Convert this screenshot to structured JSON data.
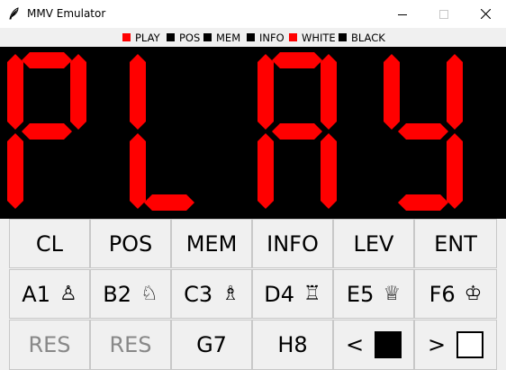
{
  "window": {
    "title": "MMV Emulator"
  },
  "indicators": [
    {
      "label": "PLAY",
      "color": "#ff0000"
    },
    {
      "label": "POS",
      "color": "#000000"
    },
    {
      "label": "MEM",
      "color": "#000000"
    },
    {
      "label": "INFO",
      "color": "#000000"
    },
    {
      "label": "WHITE",
      "color": "#ff0000"
    },
    {
      "label": "BLACK",
      "color": "#000000"
    }
  ],
  "display": {
    "text": "PLAY",
    "segment_color": "#ff0000",
    "background": "#000000"
  },
  "keys": {
    "row1": [
      {
        "label": "CL"
      },
      {
        "label": "POS"
      },
      {
        "label": "MEM"
      },
      {
        "label": "INFO"
      },
      {
        "label": "LEV"
      },
      {
        "label": "ENT"
      }
    ],
    "row2": [
      {
        "label": "A1",
        "piece": "♙",
        "icon": "pawn-icon"
      },
      {
        "label": "B2",
        "piece": "♘",
        "icon": "knight-icon"
      },
      {
        "label": "C3",
        "piece": "♗",
        "icon": "bishop-icon"
      },
      {
        "label": "D4",
        "piece": "♖",
        "icon": "rook-icon"
      },
      {
        "label": "E5",
        "piece": "♕",
        "icon": "queen-icon"
      },
      {
        "label": "F6",
        "piece": "♔",
        "icon": "king-icon"
      }
    ],
    "row3": [
      {
        "label": "RES",
        "disabled": true
      },
      {
        "label": "RES",
        "disabled": true
      },
      {
        "label": "G7"
      },
      {
        "label": "H8"
      },
      {
        "label": "<",
        "swatch": "#000000"
      },
      {
        "label": ">",
        "swatch": "#ffffff"
      }
    ]
  }
}
